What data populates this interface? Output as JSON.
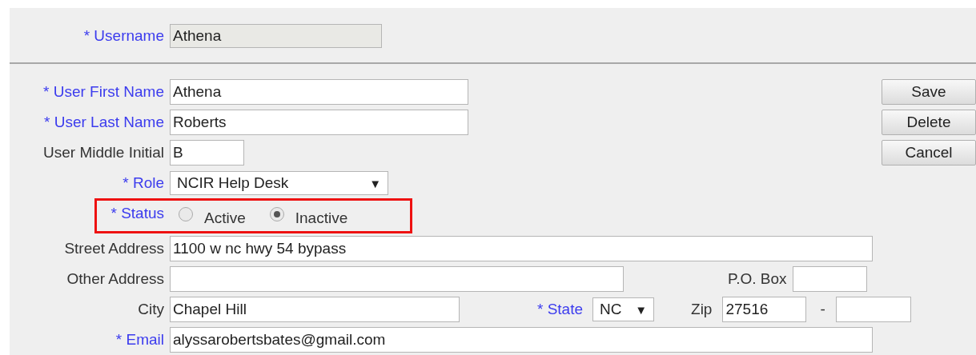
{
  "username": {
    "label": "* Username",
    "value": "Athena",
    "required": true,
    "disabled": true
  },
  "first_name": {
    "label": "* User First Name",
    "value": "Athena",
    "required": true
  },
  "last_name": {
    "label": "* User Last Name",
    "value": "Roberts",
    "required": true
  },
  "middle_initial": {
    "label": "User Middle Initial",
    "value": "B",
    "required": false
  },
  "buttons": [
    "Save",
    "Delete",
    "Cancel"
  ],
  "role": {
    "label": "* Role",
    "value": "NCIR Help Desk",
    "caret": "▼",
    "required": true
  },
  "status": {
    "label": "* Status",
    "required": true,
    "highlighted": true,
    "options": [
      {
        "label": "Active",
        "selected": false
      },
      {
        "label": "Inactive",
        "selected": true
      }
    ]
  },
  "street_address": {
    "label": "Street Address",
    "value": "1100 w nc hwy 54 bypass",
    "required": false
  },
  "other_address": {
    "label": "Other Address",
    "required": false
  },
  "po_box": {
    "label": "P.O. Box",
    "required": false
  },
  "city": {
    "label": "City",
    "value": "Chapel Hill",
    "required": false
  },
  "state": {
    "label": "* State",
    "value": "NC",
    "caret": "▼",
    "required": true
  },
  "zip": {
    "label": "Zip",
    "value": "27516",
    "required": false
  },
  "zip_extension": {
    "separator": "-"
  },
  "email": {
    "label": "* Email",
    "value": "alyssarobertsbates@gmail.com",
    "required": true
  }
}
